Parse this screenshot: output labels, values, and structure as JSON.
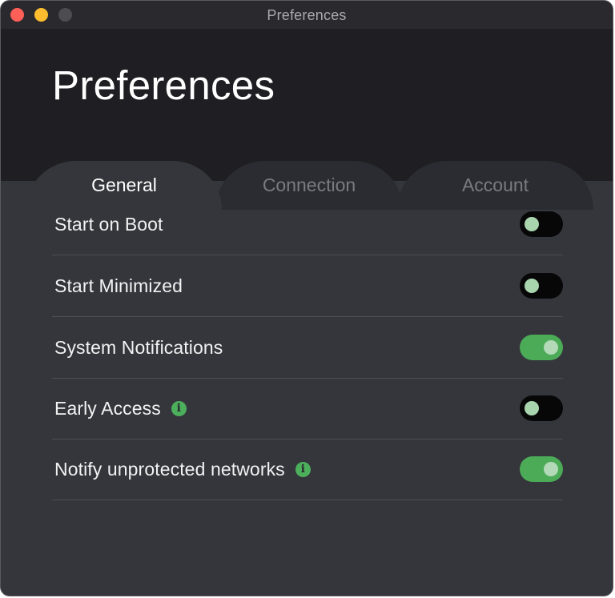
{
  "window": {
    "title": "Preferences"
  },
  "header": {
    "title": "Preferences"
  },
  "tabs": [
    {
      "label": "General",
      "active": true
    },
    {
      "label": "Connection",
      "active": false
    },
    {
      "label": "Account",
      "active": false
    }
  ],
  "settings": [
    {
      "label": "Start on Boot",
      "enabled": false,
      "info": false
    },
    {
      "label": "Start Minimized",
      "enabled": false,
      "info": false
    },
    {
      "label": "System Notifications",
      "enabled": true,
      "info": false
    },
    {
      "label": "Early Access",
      "enabled": false,
      "info": true
    },
    {
      "label": "Notify unprotected networks",
      "enabled": true,
      "info": true
    }
  ],
  "icons": {
    "info": "info-icon",
    "info_glyph": "i"
  },
  "colors": {
    "accent": "#4bab57",
    "toggle_off": "#070708",
    "background": "#35363c",
    "header": "#1f1f23"
  }
}
